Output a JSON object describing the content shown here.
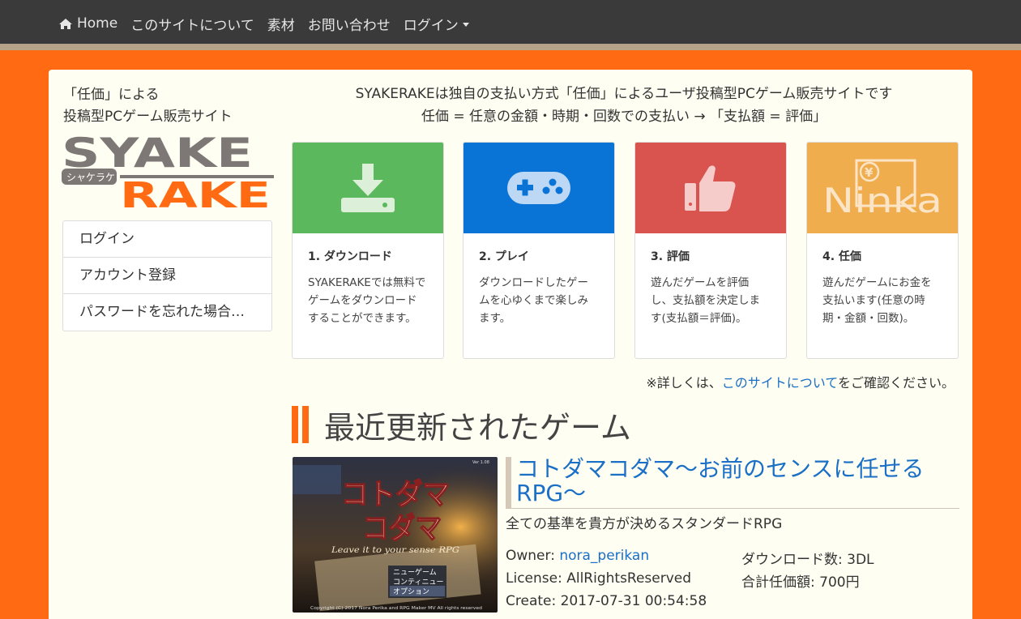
{
  "nav": {
    "home": "Home",
    "about": "このサイトについて",
    "materials": "素材",
    "contact": "お問い合わせ",
    "login": "ログイン"
  },
  "sidebar": {
    "tagline_line1": "「任価」による",
    "tagline_line2": "投稿型PCゲーム販売サイト",
    "logo_text_top": "SYAKE",
    "logo_text_bottom": "RAKE",
    "logo_kana": "シャケラケ",
    "menu": [
      {
        "label": "ログイン"
      },
      {
        "label": "アカウント登録"
      },
      {
        "label": "パスワードを忘れた場合…"
      }
    ]
  },
  "intro": {
    "line1": "SYAKERAKEは独自の支払い方式「任価」によるユーザ投稿型PCゲーム販売サイトです",
    "line2": "任価 = 任意の金額・時期・回数での支払い → 「支払額 = 評価」"
  },
  "steps": [
    {
      "title": "1. ダウンロード",
      "text": "SYAKERAKEでは無料でゲームをダウンロードすることができます。",
      "color": "#5cb85c",
      "icon": "download-icon"
    },
    {
      "title": "2. プレイ",
      "text": "ダウンロードしたゲームを心ゆくまで楽しみます。",
      "color": "#0a74d6",
      "icon": "gamepad-icon"
    },
    {
      "title": "3. 評価",
      "text": "遊んだゲームを評価し、支払額を決定します(支払額＝評価)。",
      "color": "#d9534f",
      "icon": "thumbs-up-icon"
    },
    {
      "title": "4. 任価",
      "text": "遊んだゲームにお金を支払います(任意の時期・金額・回数)。",
      "color": "#f0ad4e",
      "icon": "ninka-icon",
      "logo_text": "Ninka",
      "yen": "¥"
    }
  ],
  "note": {
    "prefix": "※詳しくは、",
    "link": "このサイトについて",
    "suffix": "をご確認ください。"
  },
  "section": {
    "title": "最近更新されたゲーム"
  },
  "game": {
    "title": "コトダマコダマ〜お前のセンスに任せるRPG〜",
    "description": "全ての基準を貴方が決めるスタンダードRPG",
    "owner_label": "Owner: ",
    "owner": "nora_perikan",
    "license": "License: AllRightsReserved",
    "create": "Create: 2017-07-31 00:54:58",
    "downloads": "ダウンロード数: 3DL",
    "total": "合計任価額: 700円",
    "thumb": {
      "logo_line1": "コトダマ",
      "logo_line2": "コダマ",
      "subtitle": "Leave it to your sense RPG",
      "menu": [
        "ニューゲーム",
        "コンティニュー",
        "オプション"
      ],
      "version": "Ver 1.08",
      "copyright": "Copyright (C) 2017 Nora Perika and RPG Maker MV  All rights reserved"
    }
  }
}
